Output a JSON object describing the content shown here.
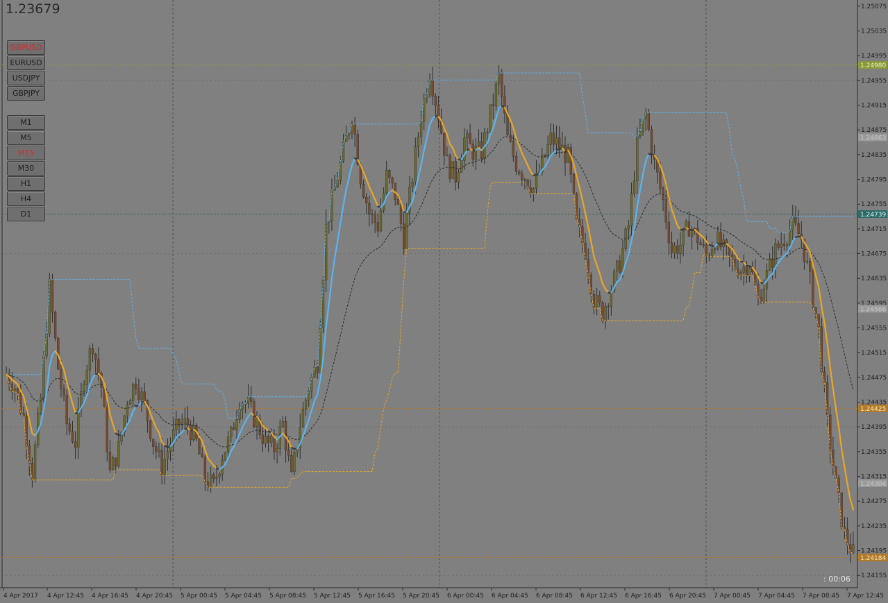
{
  "header": {
    "current_price": "1.23679"
  },
  "symbol_buttons": [
    {
      "label": "GBPUSD",
      "active": true
    },
    {
      "label": "EURUSD",
      "active": false
    },
    {
      "label": "USDJPY",
      "active": false
    },
    {
      "label": "GBPJPY",
      "active": false
    }
  ],
  "timeframe_buttons": [
    {
      "label": "M1",
      "active": false
    },
    {
      "label": "M5",
      "active": false
    },
    {
      "label": "M15",
      "active": true
    },
    {
      "label": "M30",
      "active": false
    },
    {
      "label": "H1",
      "active": false
    },
    {
      "label": "H4",
      "active": false
    },
    {
      "label": "D1",
      "active": false
    }
  ],
  "timer": {
    "label": ":  00:06"
  },
  "colors": {
    "background": "#808080",
    "grid": "#5f5f5f",
    "candle_up": "#6b6b2a",
    "candle_down": "#7a4a2e",
    "fast_ma": "#5ab4f0",
    "slow_ma": "#e8a626",
    "dark_ma": "#3a3a3a",
    "tag_green": "#8a9a3a",
    "tag_teal": "#2f6b68",
    "tag_orange": "#b07a2a",
    "tag_gray": "#9a9a9a"
  },
  "chart_data": {
    "type": "candlestick",
    "symbol": "GBPUSD",
    "timeframe": "M15",
    "y_axis": {
      "ticks": [
        "1.25075",
        "1.25035",
        "1.24995",
        "1.24955",
        "1.24915",
        "1.24875",
        "1.24835",
        "1.24795",
        "1.24755",
        "1.24715",
        "1.24675",
        "1.24635",
        "1.24595",
        "1.24555",
        "1.24515",
        "1.24475",
        "1.24435",
        "1.24395",
        "1.24355",
        "1.24315",
        "1.24275",
        "1.24235",
        "1.24195",
        "1.24155"
      ],
      "ylim": [
        1.24135,
        1.25085
      ]
    },
    "x_axis": {
      "ticks": [
        "4 Apr 2017",
        "4 Apr 12:45",
        "4 Apr 16:45",
        "4 Apr 20:45",
        "5 Apr 00:45",
        "5 Apr 04:45",
        "5 Apr 08:45",
        "5 Apr 12:45",
        "5 Apr 16:45",
        "5 Apr 20:45",
        "6 Apr 00:45",
        "6 Apr 04:45",
        "6 Apr 08:45",
        "6 Apr 12:45",
        "6 Apr 16:45",
        "6 Apr 20:45",
        "7 Apr 00:45",
        "7 Apr 04:45",
        "7 Apr 08:45",
        "7 Apr 12:45"
      ]
    },
    "price_tags": [
      {
        "value": "1.24980",
        "kind": "green"
      },
      {
        "value": "1.24863",
        "kind": "gray"
      },
      {
        "value": "1.24739",
        "kind": "teal"
      },
      {
        "value": "1.24586",
        "kind": "gray"
      },
      {
        "value": "1.24425",
        "kind": "orange"
      },
      {
        "value": "1.24304",
        "kind": "gray"
      },
      {
        "value": "1.24184",
        "kind": "orange"
      }
    ],
    "horizontal_levels": [
      {
        "value": 1.2498,
        "color": "#8a9a3a"
      },
      {
        "value": 1.24739,
        "color": "#2f6b68"
      },
      {
        "value": 1.24425,
        "color": "#b07a2a"
      },
      {
        "value": 1.24184,
        "color": "#b07a2a"
      }
    ],
    "price_path": [
      [
        0,
        1.2448
      ],
      [
        3,
        1.2446
      ],
      [
        6,
        1.2441
      ],
      [
        9,
        1.2432
      ],
      [
        12,
        1.2444
      ],
      [
        15,
        1.2462
      ],
      [
        18,
        1.2449
      ],
      [
        21,
        1.244
      ],
      [
        24,
        1.2437
      ],
      [
        27,
        1.2448
      ],
      [
        30,
        1.2453
      ],
      [
        33,
        1.2446
      ],
      [
        36,
        1.2432
      ],
      [
        39,
        1.2436
      ],
      [
        42,
        1.2444
      ],
      [
        45,
        1.2447
      ],
      [
        48,
        1.2443
      ],
      [
        51,
        1.2437
      ],
      [
        54,
        1.2433
      ],
      [
        57,
        1.2437
      ],
      [
        60,
        1.244
      ],
      [
        63,
        1.244
      ],
      [
        66,
        1.2437
      ],
      [
        69,
        1.2431
      ],
      [
        72,
        1.243
      ],
      [
        75,
        1.2435
      ],
      [
        78,
        1.2438
      ],
      [
        81,
        1.2444
      ],
      [
        84,
        1.2443
      ],
      [
        87,
        1.244
      ],
      [
        90,
        1.2437
      ],
      [
        93,
        1.2436
      ],
      [
        96,
        1.244
      ],
      [
        99,
        1.2431
      ],
      [
        102,
        1.244
      ],
      [
        105,
        1.2446
      ],
      [
        108,
        1.245
      ],
      [
        111,
        1.2472
      ],
      [
        114,
        1.2478
      ],
      [
        117,
        1.2484
      ],
      [
        120,
        1.249
      ],
      [
        123,
        1.248
      ],
      [
        126,
        1.2474
      ],
      [
        129,
        1.2472
      ],
      [
        132,
        1.248
      ],
      [
        135,
        1.2477
      ],
      [
        138,
        1.247
      ],
      [
        141,
        1.248
      ],
      [
        144,
        1.249
      ],
      [
        147,
        1.2497
      ],
      [
        150,
        1.249
      ],
      [
        153,
        1.2482
      ],
      [
        156,
        1.248
      ],
      [
        159,
        1.2486
      ],
      [
        162,
        1.2484
      ],
      [
        165,
        1.2484
      ],
      [
        168,
        1.249
      ],
      [
        171,
        1.2496
      ],
      [
        174,
        1.2486
      ],
      [
        177,
        1.2482
      ],
      [
        180,
        1.248
      ],
      [
        183,
        1.2478
      ],
      [
        186,
        1.2482
      ],
      [
        189,
        1.2486
      ],
      [
        192,
        1.2485
      ],
      [
        195,
        1.2483
      ],
      [
        198,
        1.2472
      ],
      [
        201,
        1.2468
      ],
      [
        204,
        1.246
      ],
      [
        207,
        1.2458
      ],
      [
        210,
        1.2462
      ],
      [
        213,
        1.2466
      ],
      [
        216,
        1.2472
      ],
      [
        219,
        1.2485
      ],
      [
        222,
        1.249
      ],
      [
        225,
        1.2482
      ],
      [
        228,
        1.2476
      ],
      [
        231,
        1.2468
      ],
      [
        234,
        1.2469
      ],
      [
        237,
        1.2472
      ],
      [
        240,
        1.247
      ],
      [
        243,
        1.2467
      ],
      [
        246,
        1.247
      ],
      [
        249,
        1.2468
      ],
      [
        252,
        1.2466
      ],
      [
        255,
        1.2465
      ],
      [
        258,
        1.2466
      ],
      [
        261,
        1.246
      ],
      [
        264,
        1.2464
      ],
      [
        267,
        1.2468
      ],
      [
        270,
        1.247
      ],
      [
        273,
        1.2472
      ],
      [
        276,
        1.247
      ],
      [
        279,
        1.2463
      ],
      [
        282,
        1.2455
      ],
      [
        285,
        1.244
      ],
      [
        288,
        1.243
      ],
      [
        291,
        1.2422
      ],
      [
        294,
        1.2419
      ]
    ]
  }
}
